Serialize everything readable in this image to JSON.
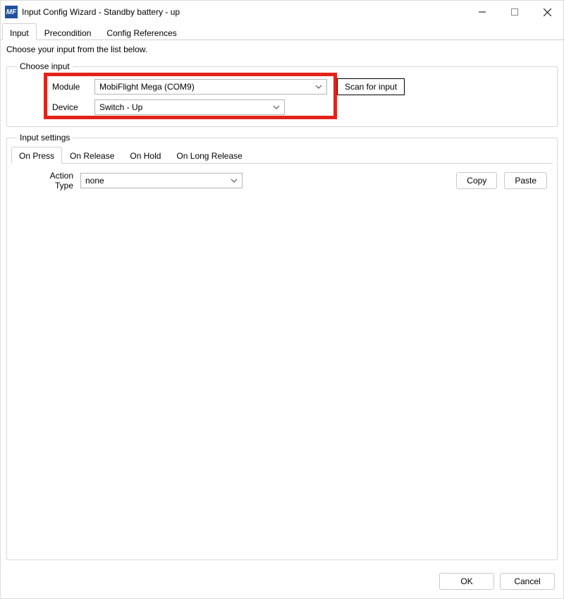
{
  "window": {
    "title": "Input Config Wizard - Standby battery - up"
  },
  "main_tabs": [
    {
      "label": "Input",
      "active": true
    },
    {
      "label": "Precondition",
      "active": false
    },
    {
      "label": "Config References",
      "active": false
    }
  ],
  "instruction": "Choose your input from the list below.",
  "choose_input": {
    "legend": "Choose input",
    "module_label": "Module",
    "module_value": "MobiFlight Mega (COM9)",
    "device_label": "Device",
    "device_value": "Switch - Up",
    "scan_label": "Scan for input"
  },
  "input_settings": {
    "legend": "Input settings",
    "tabs": [
      {
        "label": "On Press",
        "active": true
      },
      {
        "label": "On Release",
        "active": false
      },
      {
        "label": "On Hold",
        "active": false
      },
      {
        "label": "On Long Release",
        "active": false
      }
    ],
    "action_type_label": "Action Type",
    "action_type_value": "none",
    "copy_label": "Copy",
    "paste_label": "Paste"
  },
  "footer": {
    "ok": "OK",
    "cancel": "Cancel"
  }
}
